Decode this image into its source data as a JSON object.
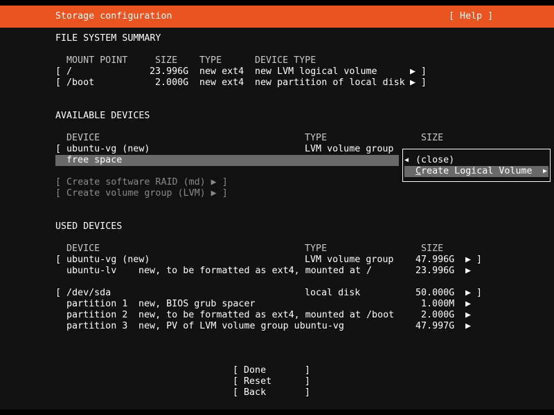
{
  "header": {
    "title": "Storage configuration",
    "help_label": "[ Help ]"
  },
  "fs_summary": {
    "heading": "FILE SYSTEM SUMMARY",
    "columns": {
      "mount": "MOUNT POINT",
      "size": "SIZE",
      "type": "TYPE",
      "device_type": "DEVICE TYPE"
    },
    "rows": [
      {
        "open": "[",
        "mount": "/",
        "size": "23.996G",
        "type": "new ext4",
        "device_type": "new LVM logical volume",
        "arrow": "▶ ]"
      },
      {
        "open": "[",
        "mount": "/boot",
        "size": "2.000G",
        "type": "new ext4",
        "device_type": "new partition of local disk",
        "arrow": "▶ ]"
      }
    ]
  },
  "available": {
    "heading": "AVAILABLE DEVICES",
    "columns": {
      "device": "DEVICE",
      "type": "TYPE",
      "size": "SIZE"
    },
    "vg_row": {
      "open": "[",
      "device": "ubuntu-vg (new)",
      "type": "LVM volume group"
    },
    "free_space": "free space",
    "raid_button": "[ Create software RAID (md) ▶ ]",
    "lvm_button": "[ Create volume group (LVM) ▶ ]"
  },
  "popup": {
    "close_arrow": "◀",
    "close_label": "(close)",
    "create_lv_label": "Create Logical Volume",
    "create_lv_hotkey": "C",
    "create_lv_rest": "reate Logical Volume",
    "arrow": "▶"
  },
  "used": {
    "heading": "USED DEVICES",
    "columns": {
      "device": "DEVICE",
      "type": "TYPE",
      "size": "SIZE"
    },
    "rows": [
      {
        "open": "[",
        "device": "ubuntu-vg (new)",
        "type": "LVM volume group",
        "size": "47.996G",
        "arrow": "▶ ]"
      },
      {
        "device": "ubuntu-lv",
        "desc": "new, to be formatted as ext4, mounted at /",
        "size": "23.996G",
        "arrow": "▶"
      },
      {
        "open": "[",
        "device": "/dev/sda",
        "type": "local disk",
        "size": "50.000G",
        "arrow": "▶ ]"
      },
      {
        "device": "partition 1",
        "desc": "new, BIOS grub spacer",
        "size": "1.000M",
        "arrow": "▶"
      },
      {
        "device": "partition 2",
        "desc": "new, to be formatted as ext4, mounted at /boot",
        "size": "2.000G",
        "arrow": "▶"
      },
      {
        "device": "partition 3",
        "desc": "new, PV of LVM volume group ubuntu-vg",
        "size": "47.997G",
        "arrow": "▶"
      }
    ]
  },
  "buttons": {
    "done": {
      "open": "[",
      "label": "Done",
      "close": "]"
    },
    "reset": {
      "open": "[",
      "label": "Reset",
      "close": "]"
    },
    "back": {
      "open": "[",
      "label": "Back",
      "close": "]"
    }
  },
  "colors": {
    "header_bg": "#e95420",
    "body_bg": "#111111",
    "highlight": "#6a6a6a",
    "disabled_text": "#8a8a8a"
  }
}
